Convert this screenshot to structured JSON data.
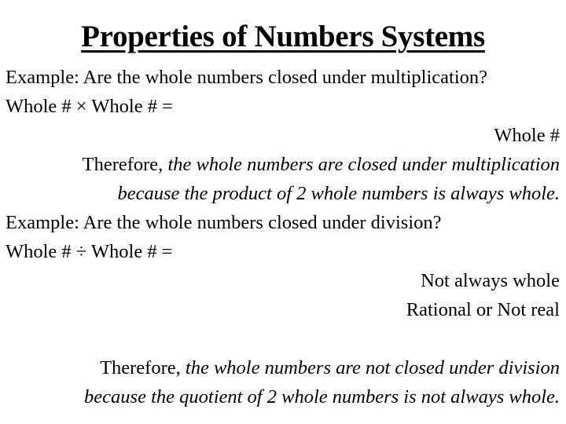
{
  "slide": {
    "title": "Properties of Numbers Systems",
    "multiplication": {
      "question": "Example: Are the whole numbers closed under multiplication?",
      "expression": "Whole # × Whole # =",
      "result": "Whole #",
      "conclusion_prefix": "Therefore, ",
      "conclusion_italic_1": "the whole numbers are closed under multiplication",
      "conclusion_italic_2": "because the product of 2 whole numbers is always whole."
    },
    "division": {
      "question": "Example: Are the whole numbers closed under division?",
      "expression": "Whole # ÷ Whole # =",
      "result_1": "Not always whole",
      "result_2": "Rational or Not real",
      "conclusion_prefix": "Therefore, ",
      "conclusion_italic_1": "the whole numbers are not closed under division",
      "conclusion_italic_2": "because the quotient of 2 whole numbers is not always whole."
    }
  }
}
